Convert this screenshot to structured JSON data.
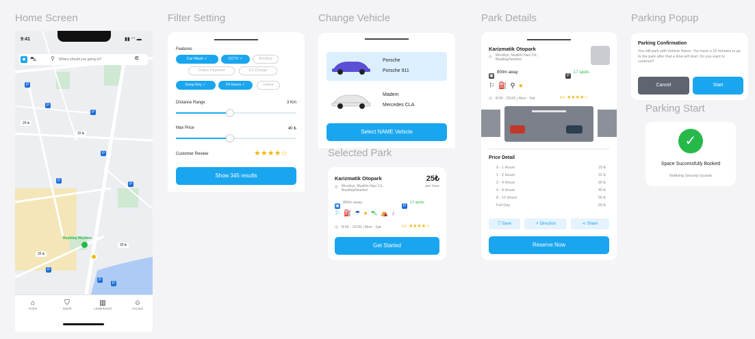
{
  "sections": {
    "home": "Home Screen",
    "filter": "Filter Setting",
    "vehicle": "Change Vehicle",
    "selected": "Selected Park",
    "details": "Park Details",
    "popup": "Parking Popup",
    "start": "Parking Start"
  },
  "home": {
    "time": "9:41",
    "search_placeholder": "Where should you going to?",
    "prices": [
      "20 ₺",
      "15 ₺",
      "30 ₺",
      "20 ₺"
    ],
    "poi": "Beşiktaş Meydanı",
    "nav": [
      "Home",
      "Saved",
      "Leaderboard",
      "Account"
    ]
  },
  "filter": {
    "features_label": "Features",
    "chips": [
      {
        "label": "Car Wash ✓",
        "on": true
      },
      {
        "label": "CCTV ✓",
        "on": true
      },
      {
        "label": "Rooftop",
        "on": false
      },
      {
        "label": "Online Payment",
        "on": false
      },
      {
        "label": "EV Charge",
        "on": false
      },
      {
        "label": "Keep Key ✓",
        "on": true
      },
      {
        "label": "24 Hours ✓",
        "on": true
      },
      {
        "label": "Indoor",
        "on": false
      }
    ],
    "distance_label": "Distance Range",
    "distance_value": "3 Km",
    "distance_fill": 0.45,
    "price_label": "Max Price",
    "price_value": "40 ₺",
    "price_fill": 0.45,
    "review_label": "Customer Review",
    "review_stars": "★★★★☆",
    "show_button": "Show 345 results"
  },
  "vehicle": {
    "cars": [
      {
        "brand": "Porsche",
        "model": "Porsche 911",
        "color": "#5b4fd6",
        "selected": true
      },
      {
        "brand": "Madem",
        "model": "Mercedes CLA",
        "color": "#e6e6e8",
        "selected": false
      }
    ],
    "select_button": "Select NAME Vehicle"
  },
  "selected": {
    "name": "Karizmatik Otopark",
    "price": "25₺",
    "per": "per hour",
    "address1": "Mecidiye, Muallim Naci Cd.,",
    "address2": "Beşiktaş/İstanbul",
    "distance": "800m away",
    "spots": "17 spots",
    "hours": "8:00 - 23:00 | Mon - Sat",
    "rating": "4.0",
    "stars": "★★★★☆",
    "button": "Get Started"
  },
  "details": {
    "name": "Karizmatik Otopark",
    "address1": "Mecidiye, Muallim Naci Cd.,",
    "address2": "Beşiktaş/İstanbul",
    "distance": "800m away",
    "spots": "17 spots",
    "hours": "8:00 - 23:00 | Mon - Sat",
    "rating": "4.0",
    "stars": "★★★★☆",
    "price_title": "Price Detail",
    "prices": [
      {
        "label": "0 - 1 Hours",
        "value": "15 ₺"
      },
      {
        "label": "1 - 2 Hours",
        "value": "22 ₺"
      },
      {
        "label": "2 - 4 Hours",
        "value": "30 ₺"
      },
      {
        "label": "4 - 8 Hours",
        "value": "40 ₺"
      },
      {
        "label": "8 - 12 Hours",
        "value": "50 ₺"
      },
      {
        "label": "Full Day",
        "value": "60 ₺"
      }
    ],
    "save": "Save",
    "direction": "Direction",
    "share": "Share",
    "reserve": "Reserve Now"
  },
  "popup": {
    "title": "Parking Confirmation",
    "text": "You will park with Vehicle Name. You have a 15 minutes to go to the park after that a time will start. Do you want to continue?",
    "cancel": "Cancel",
    "start": "Start"
  },
  "start": {
    "title": "Space Successfully Booked",
    "sub": "Notifying Security Guards"
  },
  "colors": {
    "accent": "#1aa6ef",
    "success": "#27b84a",
    "star": "#f2b60f"
  }
}
